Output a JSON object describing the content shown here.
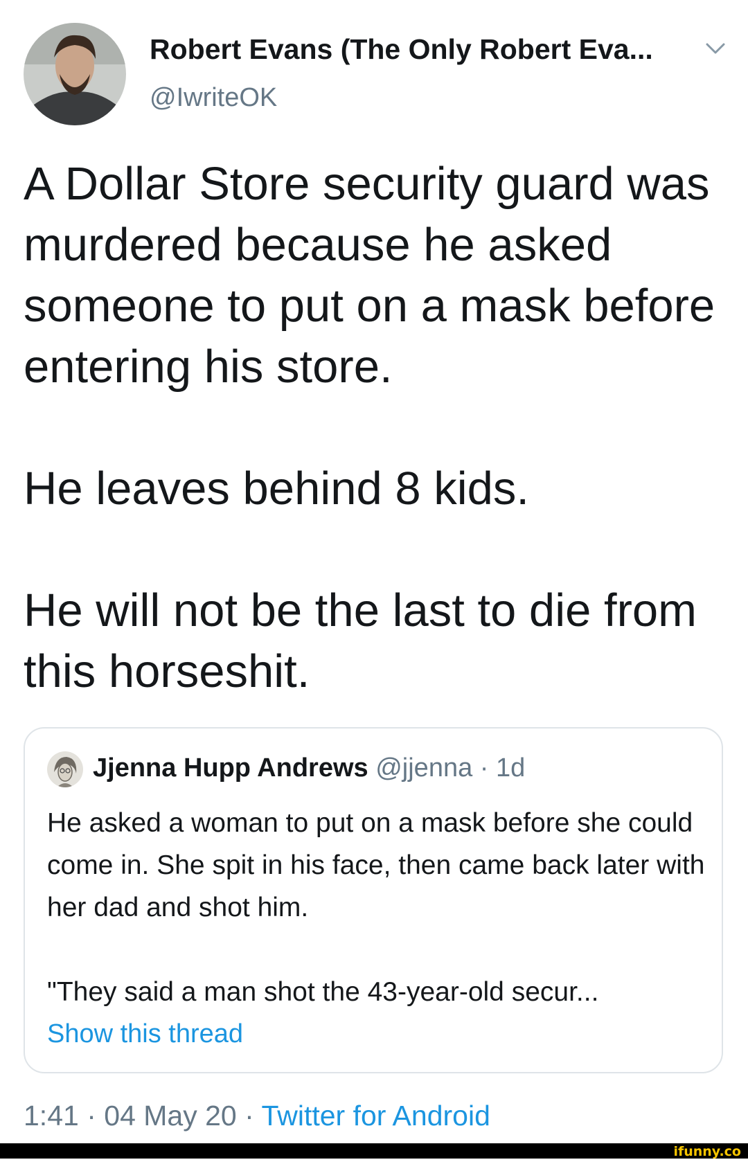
{
  "tweet": {
    "author_name": "Robert Evans (The Only Robert Eva...",
    "author_handle": "@IwriteOK",
    "paragraphs": [
      "A Dollar Store security guard was murdered because he asked someone to put on a mask before entering his store.",
      "He leaves behind 8 kids.",
      "He will not be the last to die from this horseshit."
    ],
    "timestamp_time": "1:41",
    "timestamp_date": "04 May 20",
    "separator": "·",
    "source": "Twitter for Android"
  },
  "quoted_tweet": {
    "author_name": "Jjenna Hupp Andrews",
    "author_handle": "@jjenna",
    "separator": "·",
    "time": "1d",
    "paragraphs": [
      "He asked a woman to put on a mask before she could come in. She spit in his face, then came back later with her dad and shot him.",
      "\"They said a man shot the 43-year-old secur..."
    ],
    "show_thread": "Show this thread"
  },
  "watermark": {
    "text": "ifunny.co",
    "color": "#f5c400"
  },
  "icons": {
    "menu": "chevron-down-icon"
  },
  "colors": {
    "accent": "#1b95e0",
    "secondary_text": "#657786",
    "card_border": "#dfe4e8"
  }
}
